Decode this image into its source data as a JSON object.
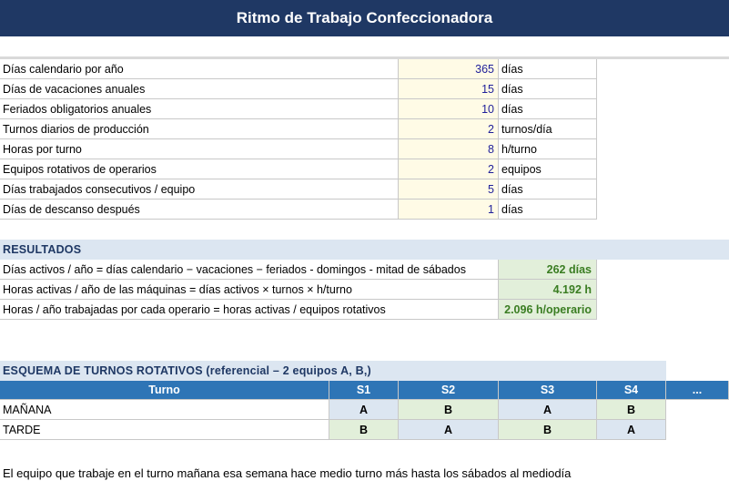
{
  "title": "Ritmo de Trabajo Confeccionadora",
  "inputs": [
    {
      "label": "Días calendario por año",
      "value": "365",
      "unit": "días"
    },
    {
      "label": "Días de vacaciones anuales",
      "value": "15",
      "unit": "días"
    },
    {
      "label": "Feriados obligatorios anuales",
      "value": "10",
      "unit": "días"
    },
    {
      "label": "Turnos diarios de producción",
      "value": "2",
      "unit": "turnos/día"
    },
    {
      "label": "Horas por turno",
      "value": "8",
      "unit": "h/turno"
    },
    {
      "label": "Equipos rotativos de operarios",
      "value": "2",
      "unit": "equipos"
    },
    {
      "label": "Días trabajados consecutivos / equipo",
      "value": "5",
      "unit": "días"
    },
    {
      "label": "Días de descanso después",
      "value": "1",
      "unit": "días"
    }
  ],
  "results": {
    "header": "RESULTADOS",
    "rows": [
      {
        "label": "Días activos / año = días calendario − vacaciones − feriados - domingos - mitad de sábados",
        "value": "262 días"
      },
      {
        "label": "Horas activas / año de las máquinas = días activos × turnos × h/turno",
        "value": "4.192 h"
      },
      {
        "label": "Horas / año trabajadas por cada operario = horas activas / equipos rotativos",
        "value": "2.096 h/operario"
      }
    ]
  },
  "schedule": {
    "header": "ESQUEMA DE TURNOS ROTATIVOS  (referencial – 2 equipos A, B,)",
    "columns": [
      "Turno",
      "S1",
      "S2",
      "S3",
      "S4",
      "..."
    ],
    "rows": [
      {
        "shift": "MAÑANA",
        "cells": [
          "A",
          "B",
          "A",
          "B"
        ]
      },
      {
        "shift": "TARDE",
        "cells": [
          "B",
          "A",
          "B",
          "A"
        ]
      }
    ]
  },
  "note": "El equipo que trabaje en el turno mañana esa semana hace medio turno más hasta los sábados al mediodía",
  "colors": {
    "title_bg": "#1f3864",
    "header_bg": "#2e75b6",
    "input_bg": "#fffbe6",
    "result_bg": "#e2efda",
    "team_a_bg": "#dce6f1",
    "team_b_bg": "#e2efda"
  }
}
